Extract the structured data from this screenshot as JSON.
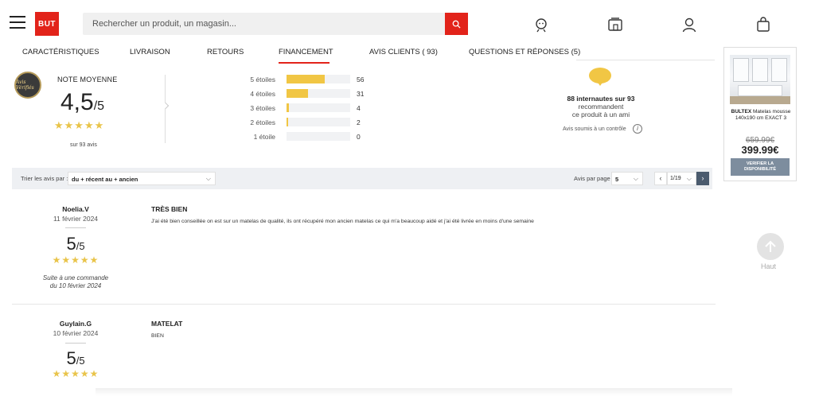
{
  "header": {
    "logo_text": "BUT",
    "search_placeholder": "Rechercher un produit, un magasin...",
    "icons": [
      "menu-icon",
      "search-icon",
      "advisor-icon",
      "store-icon",
      "account-icon",
      "cart-icon"
    ],
    "accent_color": "#e2231a"
  },
  "tabs": [
    {
      "label": "CARACTÉRISTIQUES"
    },
    {
      "label": "LIVRAISON"
    },
    {
      "label": "RETOURS"
    },
    {
      "label": "FINANCEMENT",
      "active": true
    },
    {
      "label": "AVIS CLIENTS ( 93)"
    },
    {
      "label": "QUESTIONS ET RÉPONSES (5)"
    }
  ],
  "summary": {
    "badge_text": "Avis Vérifiés",
    "note_label": "NOTE MOYENNE",
    "score": "4,5",
    "score_den": "/5",
    "stars": "★★★★★",
    "count_text": "sur 93 avis",
    "distribution": [
      {
        "label": "5 étoiles",
        "count": "56",
        "fraction": 0.602
      },
      {
        "label": "4 étoiles",
        "count": "31",
        "fraction": 0.333
      },
      {
        "label": "3 étoiles",
        "count": "4",
        "fraction": 0.043
      },
      {
        "label": "2 étoiles",
        "count": "2",
        "fraction": 0.022
      },
      {
        "label": "1 étoile",
        "count": "0",
        "fraction": 0
      }
    ],
    "reco_bold": "88 internautes sur 93",
    "reco_line2": "recommandent",
    "reco_line3": "ce produit à un ami",
    "controle_text": "Avis soumis à un contrôle",
    "info_glyph": "i",
    "bar_color": "#f1c644"
  },
  "filter": {
    "sort_label": "Trier les avis par :",
    "sort_value": "du + récent au + ancien",
    "per_page_label": "Avis par page :",
    "per_page_value": "5",
    "page_value": "1/19",
    "prev_glyph": "‹",
    "next_glyph": "›"
  },
  "reviews": [
    {
      "author": "Noelia.V",
      "date": "11 février 2024",
      "score": "5",
      "score_den": "/5",
      "stars": "★★★★★",
      "order_line1": "Suite à une commande",
      "order_line2": "du 10 février 2024",
      "title": "TRÈS BIEN",
      "text": "J'ai été bien conseillée on est sur un matelas de qualité, ils ont récupéré mon ancien matelas ce qui m'a beaucoup aidé et j'ai été livrée en moins d'une semaine"
    },
    {
      "author": "Guylain.G",
      "date": "10 février 2024",
      "score": "5",
      "score_den": "/5",
      "stars": "★★★★★",
      "title": "MATELAT",
      "text": "BIEN"
    }
  ],
  "ad": {
    "brand": "BULTEX",
    "title_rest": " Matelas mousse 140x190 cm EXACT 3",
    "old_price": "659.99€",
    "price": "399.99€",
    "button_label": "VERIFIER LA DISPONIBILITÉ"
  },
  "haut_label": "Haut"
}
